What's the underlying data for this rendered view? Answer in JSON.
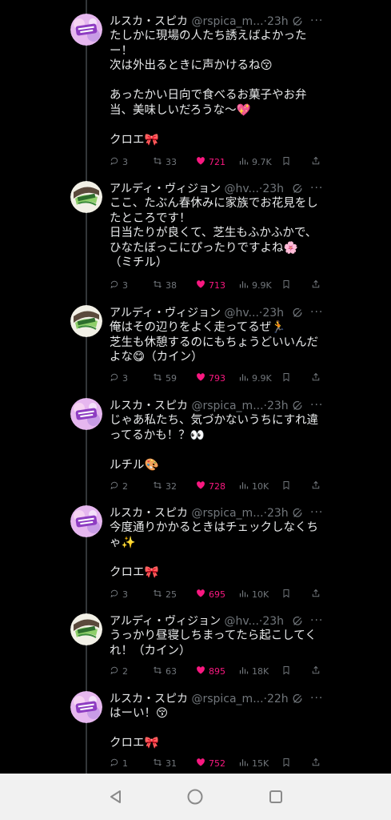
{
  "tweets": [
    {
      "name": "ルスカ・スピカ",
      "handle": "@rspica_m...",
      "time": "·23h",
      "avatar": "rspica",
      "lines": [
        "たしかに現場の人たち誘えばよかったー！",
        "次は外出るときに声かけるね😚",
        "",
        "あったかい日向で食べるお菓子やお弁当、美味しいだろうな～💖",
        "",
        "クロエ🎀"
      ],
      "replies": "3",
      "reposts": "33",
      "likes": "721",
      "views": "9.7K"
    },
    {
      "name": "アルディ・ヴィジョン",
      "handle": "@hv...",
      "time": "·23h",
      "avatar": "hv",
      "lines": [
        "ここ、たぶん春休みに家族でお花見をしたところです！",
        "日当たりが良くて、芝生もふかふかで、ひなたぼっこにぴったりですよね🌸",
        "（ミチル）"
      ],
      "replies": "3",
      "reposts": "38",
      "likes": "713",
      "views": "9.9K"
    },
    {
      "name": "アルディ・ヴィジョン",
      "handle": "@hv...",
      "time": "·23h",
      "avatar": "hv",
      "lines": [
        "俺はその辺りをよく走ってるぜ🏃",
        "芝生も休憩するのにもちょうどいいんだよな😋（カイン）"
      ],
      "replies": "3",
      "reposts": "59",
      "likes": "793",
      "views": "9.9K"
    },
    {
      "name": "ルスカ・スピカ",
      "handle": "@rspica_m...",
      "time": "·23h",
      "avatar": "rspica",
      "lines": [
        "じゃあ私たち、気づかないうちにすれ違ってるかも！？👀",
        "",
        "ルチル🎨"
      ],
      "replies": "2",
      "reposts": "32",
      "likes": "728",
      "views": "10K"
    },
    {
      "name": "ルスカ・スピカ",
      "handle": "@rspica_m...",
      "time": "·23h",
      "avatar": "rspica",
      "lines": [
        "今度通りかかるときはチェックしなくちゃ✨",
        "",
        "クロエ🎀"
      ],
      "replies": "3",
      "reposts": "25",
      "likes": "695",
      "views": "10K"
    },
    {
      "name": "アルディ・ヴィジョン",
      "handle": "@hv...",
      "time": "·23h",
      "avatar": "hv",
      "lines": [
        "うっかり昼寝しちまってたら起こしてくれ！（カイン）"
      ],
      "replies": "2",
      "reposts": "63",
      "likes": "895",
      "views": "18K"
    },
    {
      "name": "ルスカ・スピカ",
      "handle": "@rspica_m...",
      "time": "·22h",
      "avatar": "rspica",
      "lines": [
        "はーい！😚",
        "",
        "クロエ🎀"
      ],
      "replies": "1",
      "reposts": "31",
      "likes": "752",
      "views": "15K"
    }
  ],
  "colors": {
    "like": "#f91880",
    "muted": "#71767b",
    "text": "#e7e9ea",
    "background": "#000000"
  },
  "navbar": {
    "back": "back-icon",
    "home": "home-icon",
    "recents": "recents-icon"
  }
}
